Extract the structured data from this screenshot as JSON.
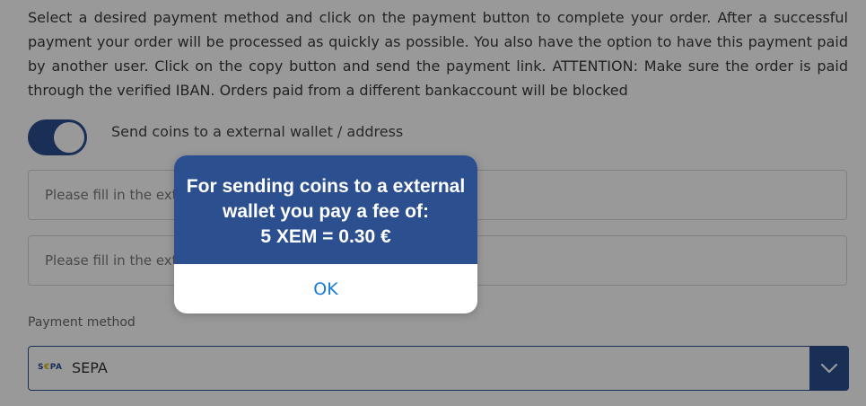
{
  "intro": {
    "text": "Select a desired payment method and click on the payment button to complete your order. After a successful payment your order will be processed as quickly as possible. You also have the option to have this payment paid by another user. Click on the copy button and send the payment link. ATTENTION: Make sure the order is paid through the verified IBAN. Orders paid from a different bankaccount will be blocked"
  },
  "toggle": {
    "label": "Send coins to a external wallet / address",
    "state": "on",
    "color": "#2b4f8f"
  },
  "fields": [
    {
      "placeholder": "Please fill in the external wallet address",
      "value": ""
    },
    {
      "placeholder": "Please fill in the external wallet tag",
      "value": ""
    }
  ],
  "payment": {
    "label": "Payment method",
    "selected": "SEPA",
    "logo_text": "SEPA",
    "dropdown_icon": "chevron-down-icon"
  },
  "modal": {
    "line1": "For sending coins to a external",
    "line2": "wallet you pay a fee of:",
    "line3": "5 XEM = 0.30 €",
    "ok_label": "OK",
    "header_color": "#2b4f8f",
    "button_color": "#1a7bd6"
  }
}
